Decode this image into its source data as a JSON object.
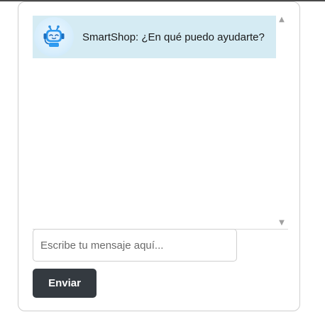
{
  "chat": {
    "messages": [
      {
        "sender": "bot",
        "avatar_icon": "robot-headset-icon",
        "text": "SmartShop: ¿En qué puedo ayudarte?"
      }
    ],
    "input": {
      "value": "",
      "placeholder": "Escribe tu mensaje aquí..."
    },
    "send_label": "Enviar"
  },
  "colors": {
    "bot_bubble": "#d5ebf3",
    "send_button": "#343a40",
    "send_text": "#ffffff"
  }
}
